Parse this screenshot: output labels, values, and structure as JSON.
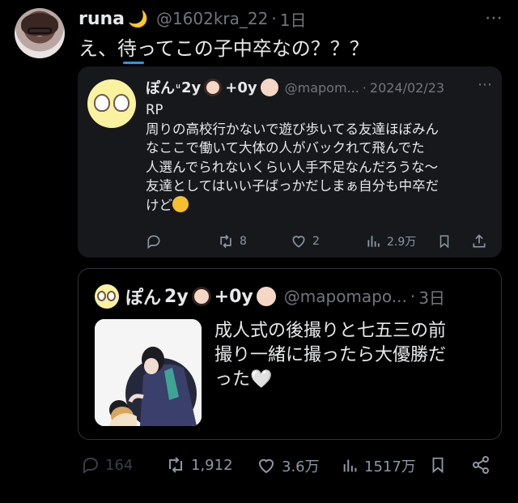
{
  "tweet": {
    "author_name": "runa",
    "author_emoji": "🌙",
    "handle": "@1602kra_22",
    "separator": "·",
    "time": "1日",
    "more": "⋯",
    "text": "え、待ってこの子中卒なの？？？"
  },
  "quote1": {
    "name": "ぽん",
    "name_extra": "2y",
    "name_extra2": "+0y",
    "handle": "@mapom...",
    "separator": "·",
    "date": "2024/02/23",
    "more": "⋯",
    "lines": [
      "RP",
      "周りの高校行かないで遊び歩いてる友達ほぼみん",
      "なここで働いて大体の人がバックれて飛んでた",
      "人選んでられないくらい人手不足なんだろうな〜",
      "友達としてはいい子ばっかだしまぁ自分も中卒だ",
      "けど"
    ],
    "actions": {
      "reply_count": "",
      "retweet_count": "8",
      "like_count": "2",
      "view_count": "2.9万"
    }
  },
  "quote2": {
    "name": "ぽん",
    "name_extra": "2y",
    "name_extra2": "+0y",
    "handle": "@mapomapo...",
    "separator": "·",
    "time": "3日",
    "lines": [
      "成人式の後撮りと七五三の前",
      "撮り一緒に撮ったら大優勝だ",
      "った"
    ],
    "heart": "🤍"
  },
  "actions": {
    "reply_count": "164",
    "retweet_count": "1,912",
    "like_count": "3.6万",
    "view_count": "1517万"
  },
  "colors": {
    "background": "#000000",
    "card_bg": "#16181c",
    "muted": "#71767b",
    "accent": "#1d9bf0",
    "text": "#e7e9ea"
  }
}
